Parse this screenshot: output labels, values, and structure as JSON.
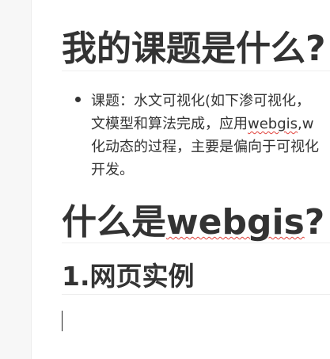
{
  "document": {
    "heading1": "我的课题是什么?",
    "bullet_line1": "课题：水文可视化(如下渗可视化，",
    "bullet_line2_a": "文模型和算法完成，应用",
    "bullet_line2_spell": "webgis",
    "bullet_line2_b": ",w",
    "bullet_line3": "化动态的过程，主要是偏向于可视化",
    "bullet_line4": "开发。",
    "heading2_a": "什么是",
    "heading2_spell": "webgis",
    "heading2_b": "?",
    "heading3": "1.网页实例"
  }
}
